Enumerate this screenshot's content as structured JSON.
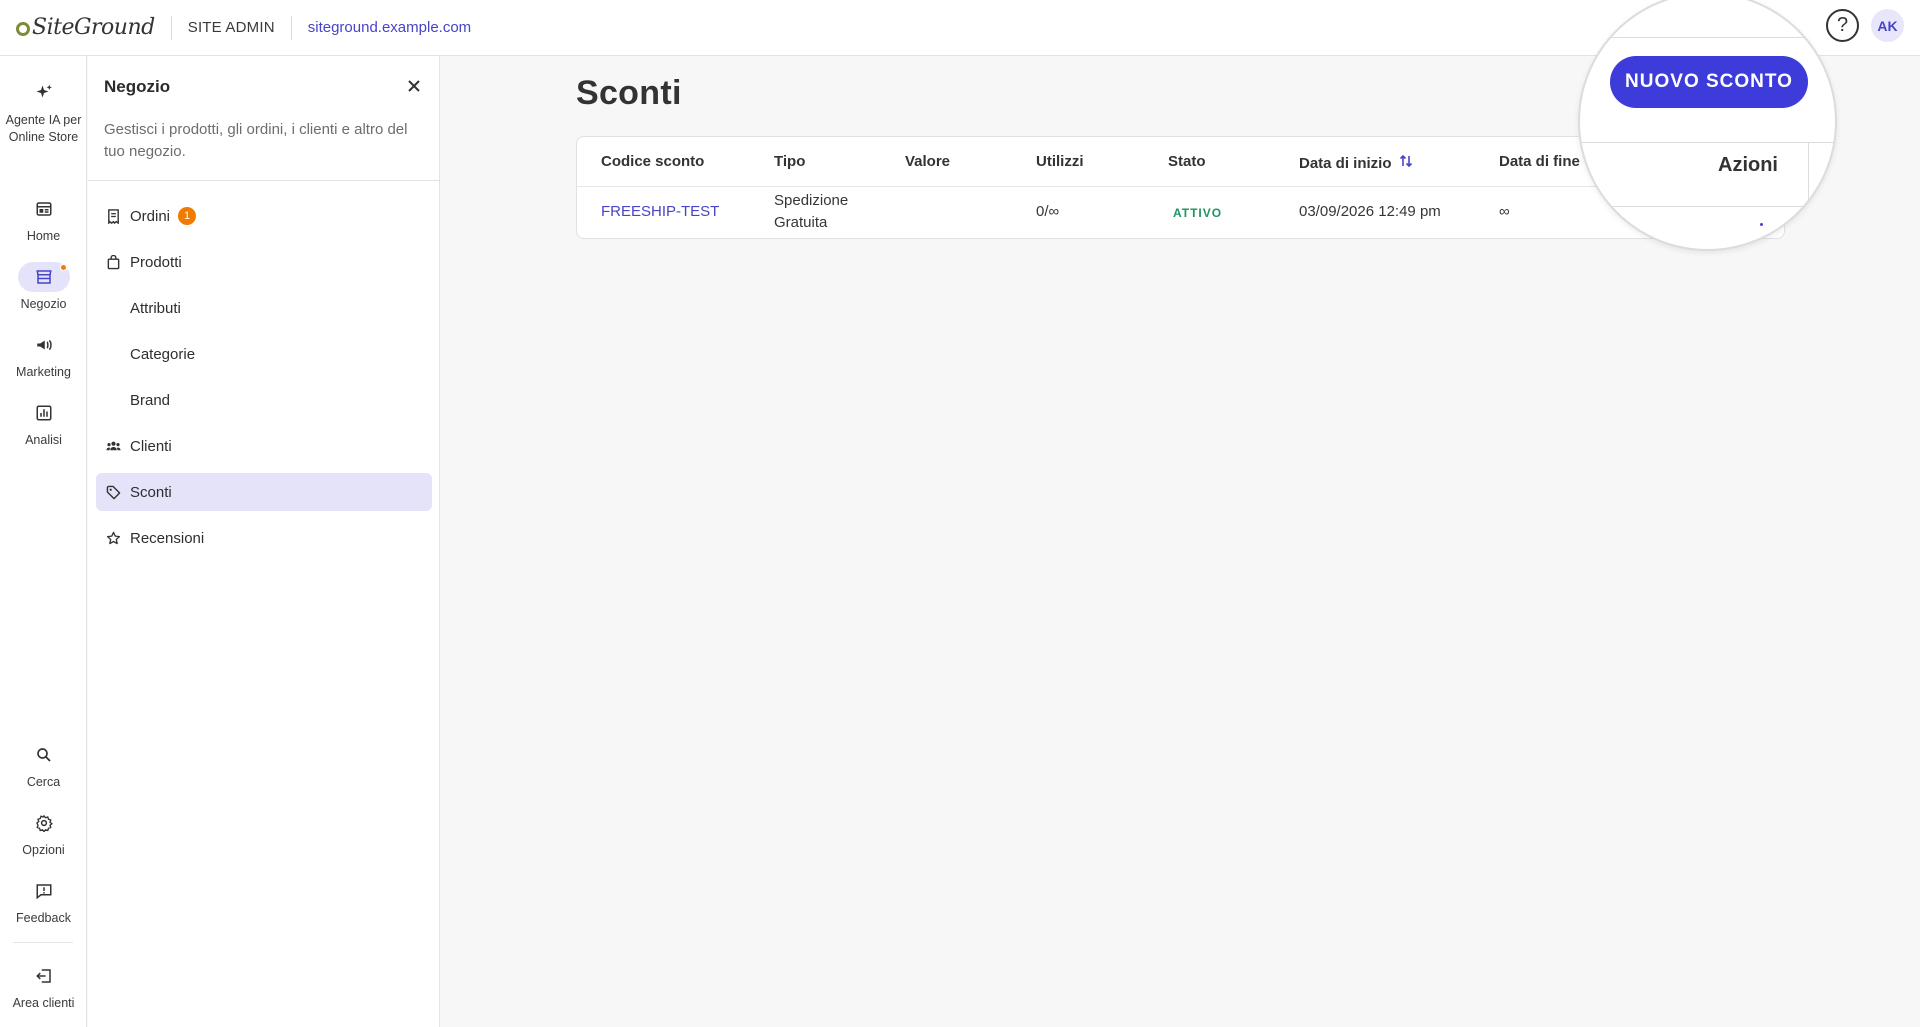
{
  "header": {
    "logo_text": "SiteGround",
    "section_label": "SITE ADMIN",
    "site_url": "siteground.example.com",
    "help_label": "?",
    "avatar_initials": "AK"
  },
  "rail": {
    "items": [
      {
        "label": "Agente IA per Online Store",
        "icon": "sparkle-icon"
      },
      {
        "label": "Home",
        "icon": "home-icon"
      },
      {
        "label": "Negozio",
        "icon": "store-icon",
        "active": true
      },
      {
        "label": "Marketing",
        "icon": "megaphone-icon"
      },
      {
        "label": "Analisi",
        "icon": "chart-icon"
      },
      {
        "label": "Cerca",
        "icon": "search-icon"
      },
      {
        "label": "Opzioni",
        "icon": "gear-icon"
      },
      {
        "label": "Feedback",
        "icon": "feedback-icon"
      },
      {
        "label": "Area clienti",
        "icon": "exit-icon"
      }
    ]
  },
  "panel": {
    "title": "Negozio",
    "description": "Gestisci i prodotti, gli ordini, i clienti e altro del tuo negozio.",
    "items": [
      {
        "label": "Ordini",
        "badge": "1",
        "icon": "receipt-icon"
      },
      {
        "label": "Prodotti",
        "icon": "bag-icon"
      },
      {
        "label": "Attributi"
      },
      {
        "label": "Categorie"
      },
      {
        "label": "Brand"
      },
      {
        "label": "Clienti",
        "icon": "people-icon"
      },
      {
        "label": "Sconti",
        "icon": "tag-icon",
        "active": true
      },
      {
        "label": "Recensioni",
        "icon": "star-icon"
      }
    ]
  },
  "main": {
    "title": "Sconti",
    "new_button": "NUOVO SCONTO",
    "columns": [
      "Codice sconto",
      "Tipo",
      "Valore",
      "Utilizzi",
      "Stato",
      "Data di inizio",
      "Data di fine",
      "Azioni"
    ],
    "rows": [
      {
        "code": "FREESHIP-TEST",
        "type": "Spedizione Gratuita",
        "value": "",
        "usage": "0/∞",
        "status": "ATTIVO",
        "start": "03/09/2026 12:49 pm",
        "end": "∞"
      }
    ]
  },
  "colors": {
    "accent": "#3d3bd9",
    "link": "#4744c8",
    "active_bg": "#e4e3f9",
    "badge": "#f07b00",
    "status_active": "#1f9460"
  }
}
